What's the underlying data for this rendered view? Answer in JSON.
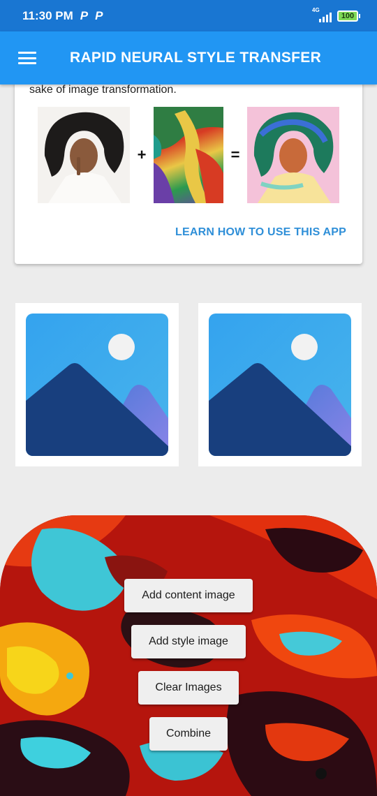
{
  "status_bar": {
    "time": "11:30 PM",
    "notification_icons": [
      "P",
      "P"
    ],
    "network": "4G",
    "battery": "100"
  },
  "app_bar": {
    "title": "RAPID NEURAL STYLE TRANSFER",
    "menu_icon": "hamburger-menu-icon"
  },
  "info_card": {
    "text": "sake of image transformation.",
    "operator_plus": "+",
    "operator_equals": "=",
    "learn_link": "LEARN HOW TO USE THIS APP"
  },
  "pickers": {
    "content_placeholder_icon": "image-placeholder-icon",
    "style_placeholder_icon": "image-placeholder-icon"
  },
  "actions": {
    "add_content": "Add content image",
    "add_style": "Add style image",
    "clear": "Clear Images",
    "combine": "Combine"
  },
  "colors": {
    "status_bar": "#1976d2",
    "app_bar": "#2196f3",
    "link": "#2f8fd8",
    "background": "#ececec"
  }
}
